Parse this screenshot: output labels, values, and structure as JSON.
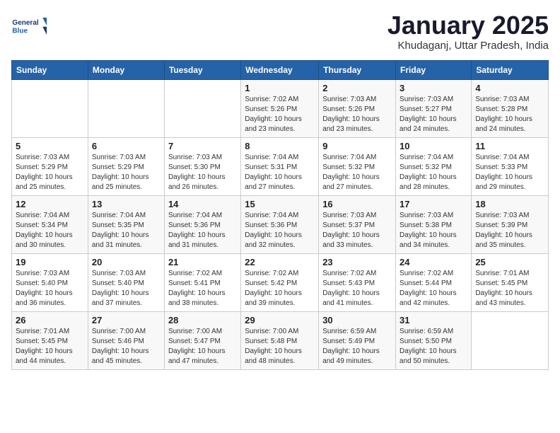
{
  "logo": {
    "name": "General Blue",
    "line1": "General",
    "line2": "Blue"
  },
  "title": "January 2025",
  "subtitle": "Khudaganj, Uttar Pradesh, India",
  "headers": [
    "Sunday",
    "Monday",
    "Tuesday",
    "Wednesday",
    "Thursday",
    "Friday",
    "Saturday"
  ],
  "weeks": [
    [
      {
        "day": "",
        "info": ""
      },
      {
        "day": "",
        "info": ""
      },
      {
        "day": "",
        "info": ""
      },
      {
        "day": "1",
        "info": "Sunrise: 7:02 AM\nSunset: 5:26 PM\nDaylight: 10 hours\nand 23 minutes."
      },
      {
        "day": "2",
        "info": "Sunrise: 7:03 AM\nSunset: 5:26 PM\nDaylight: 10 hours\nand 23 minutes."
      },
      {
        "day": "3",
        "info": "Sunrise: 7:03 AM\nSunset: 5:27 PM\nDaylight: 10 hours\nand 24 minutes."
      },
      {
        "day": "4",
        "info": "Sunrise: 7:03 AM\nSunset: 5:28 PM\nDaylight: 10 hours\nand 24 minutes."
      }
    ],
    [
      {
        "day": "5",
        "info": "Sunrise: 7:03 AM\nSunset: 5:29 PM\nDaylight: 10 hours\nand 25 minutes."
      },
      {
        "day": "6",
        "info": "Sunrise: 7:03 AM\nSunset: 5:29 PM\nDaylight: 10 hours\nand 25 minutes."
      },
      {
        "day": "7",
        "info": "Sunrise: 7:03 AM\nSunset: 5:30 PM\nDaylight: 10 hours\nand 26 minutes."
      },
      {
        "day": "8",
        "info": "Sunrise: 7:04 AM\nSunset: 5:31 PM\nDaylight: 10 hours\nand 27 minutes."
      },
      {
        "day": "9",
        "info": "Sunrise: 7:04 AM\nSunset: 5:32 PM\nDaylight: 10 hours\nand 27 minutes."
      },
      {
        "day": "10",
        "info": "Sunrise: 7:04 AM\nSunset: 5:32 PM\nDaylight: 10 hours\nand 28 minutes."
      },
      {
        "day": "11",
        "info": "Sunrise: 7:04 AM\nSunset: 5:33 PM\nDaylight: 10 hours\nand 29 minutes."
      }
    ],
    [
      {
        "day": "12",
        "info": "Sunrise: 7:04 AM\nSunset: 5:34 PM\nDaylight: 10 hours\nand 30 minutes."
      },
      {
        "day": "13",
        "info": "Sunrise: 7:04 AM\nSunset: 5:35 PM\nDaylight: 10 hours\nand 31 minutes."
      },
      {
        "day": "14",
        "info": "Sunrise: 7:04 AM\nSunset: 5:36 PM\nDaylight: 10 hours\nand 31 minutes."
      },
      {
        "day": "15",
        "info": "Sunrise: 7:04 AM\nSunset: 5:36 PM\nDaylight: 10 hours\nand 32 minutes."
      },
      {
        "day": "16",
        "info": "Sunrise: 7:03 AM\nSunset: 5:37 PM\nDaylight: 10 hours\nand 33 minutes."
      },
      {
        "day": "17",
        "info": "Sunrise: 7:03 AM\nSunset: 5:38 PM\nDaylight: 10 hours\nand 34 minutes."
      },
      {
        "day": "18",
        "info": "Sunrise: 7:03 AM\nSunset: 5:39 PM\nDaylight: 10 hours\nand 35 minutes."
      }
    ],
    [
      {
        "day": "19",
        "info": "Sunrise: 7:03 AM\nSunset: 5:40 PM\nDaylight: 10 hours\nand 36 minutes."
      },
      {
        "day": "20",
        "info": "Sunrise: 7:03 AM\nSunset: 5:40 PM\nDaylight: 10 hours\nand 37 minutes."
      },
      {
        "day": "21",
        "info": "Sunrise: 7:02 AM\nSunset: 5:41 PM\nDaylight: 10 hours\nand 38 minutes."
      },
      {
        "day": "22",
        "info": "Sunrise: 7:02 AM\nSunset: 5:42 PM\nDaylight: 10 hours\nand 39 minutes."
      },
      {
        "day": "23",
        "info": "Sunrise: 7:02 AM\nSunset: 5:43 PM\nDaylight: 10 hours\nand 41 minutes."
      },
      {
        "day": "24",
        "info": "Sunrise: 7:02 AM\nSunset: 5:44 PM\nDaylight: 10 hours\nand 42 minutes."
      },
      {
        "day": "25",
        "info": "Sunrise: 7:01 AM\nSunset: 5:45 PM\nDaylight: 10 hours\nand 43 minutes."
      }
    ],
    [
      {
        "day": "26",
        "info": "Sunrise: 7:01 AM\nSunset: 5:45 PM\nDaylight: 10 hours\nand 44 minutes."
      },
      {
        "day": "27",
        "info": "Sunrise: 7:00 AM\nSunset: 5:46 PM\nDaylight: 10 hours\nand 45 minutes."
      },
      {
        "day": "28",
        "info": "Sunrise: 7:00 AM\nSunset: 5:47 PM\nDaylight: 10 hours\nand 47 minutes."
      },
      {
        "day": "29",
        "info": "Sunrise: 7:00 AM\nSunset: 5:48 PM\nDaylight: 10 hours\nand 48 minutes."
      },
      {
        "day": "30",
        "info": "Sunrise: 6:59 AM\nSunset: 5:49 PM\nDaylight: 10 hours\nand 49 minutes."
      },
      {
        "day": "31",
        "info": "Sunrise: 6:59 AM\nSunset: 5:50 PM\nDaylight: 10 hours\nand 50 minutes."
      },
      {
        "day": "",
        "info": ""
      }
    ]
  ]
}
